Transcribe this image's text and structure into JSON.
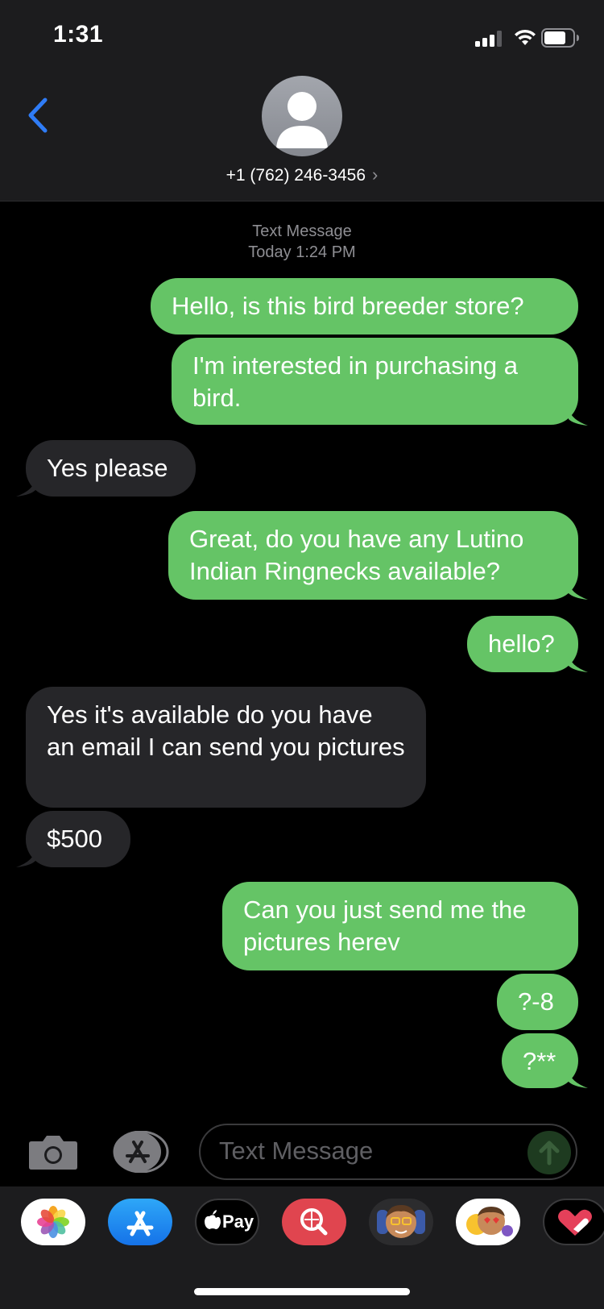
{
  "status_bar": {
    "time": "1:31"
  },
  "header": {
    "contact": "+1 (762) 246-3456",
    "chevron": "›"
  },
  "conversation": {
    "service": "Text Message",
    "timestamp": "Today 1:24 PM",
    "messages": [
      {
        "from": "me",
        "text": "Hello, is this bird breeder store?"
      },
      {
        "from": "me",
        "text": "I'm interested in purchasing a bird."
      },
      {
        "from": "them",
        "text": "Yes please"
      },
      {
        "from": "me",
        "text": "Great, do you have any Lutino Indian Ringnecks available?"
      },
      {
        "from": "me",
        "text": "hello?"
      },
      {
        "from": "them",
        "text": "Yes it's available do you have an email I can send you pictures"
      },
      {
        "from": "them",
        "text": "$500"
      },
      {
        "from": "me",
        "text": "Can you just send me the pictures herev"
      },
      {
        "from": "me",
        "text": "?-8"
      },
      {
        "from": "me",
        "text": "?**"
      }
    ]
  },
  "composer": {
    "placeholder": "Text Message"
  },
  "app_tray": {
    "apps": [
      {
        "name": "photos-icon"
      },
      {
        "name": "app-store-icon"
      },
      {
        "name": "apple-pay-icon",
        "label": "Pay"
      },
      {
        "name": "web-search-icon"
      },
      {
        "name": "memoji-icon"
      },
      {
        "name": "memoji-stickers-icon"
      },
      {
        "name": "digital-touch-icon"
      }
    ]
  },
  "colors": {
    "sent_bubble": "#65c466",
    "received_bubble": "#262629",
    "accent": "#2f7cf6",
    "background": "#000000"
  }
}
